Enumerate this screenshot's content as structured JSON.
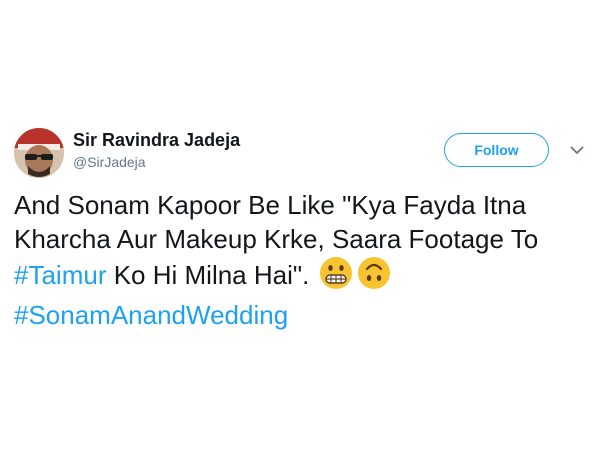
{
  "tweet": {
    "author": {
      "name": "Sir Ravindra Jadeja",
      "handle": "@SirJadeja"
    },
    "follow_label": "Follow",
    "text": {
      "line1": "And Sonam Kapoor Be Like \"Kya Fayda Itna",
      "line2": "Kharcha Aur Makeup Krke, Saara Footage To",
      "hashtag1": "#Taimur",
      "line3_rest": " Ko Hi Milna Hai\".",
      "hashtag2": "#SonamAnandWedding"
    },
    "emojis": [
      "grimacing-face",
      "upside-down-face"
    ]
  },
  "colors": {
    "link": "#1da1f2",
    "text": "#14171a",
    "muted": "#657786",
    "emoji": "#f7c331"
  }
}
